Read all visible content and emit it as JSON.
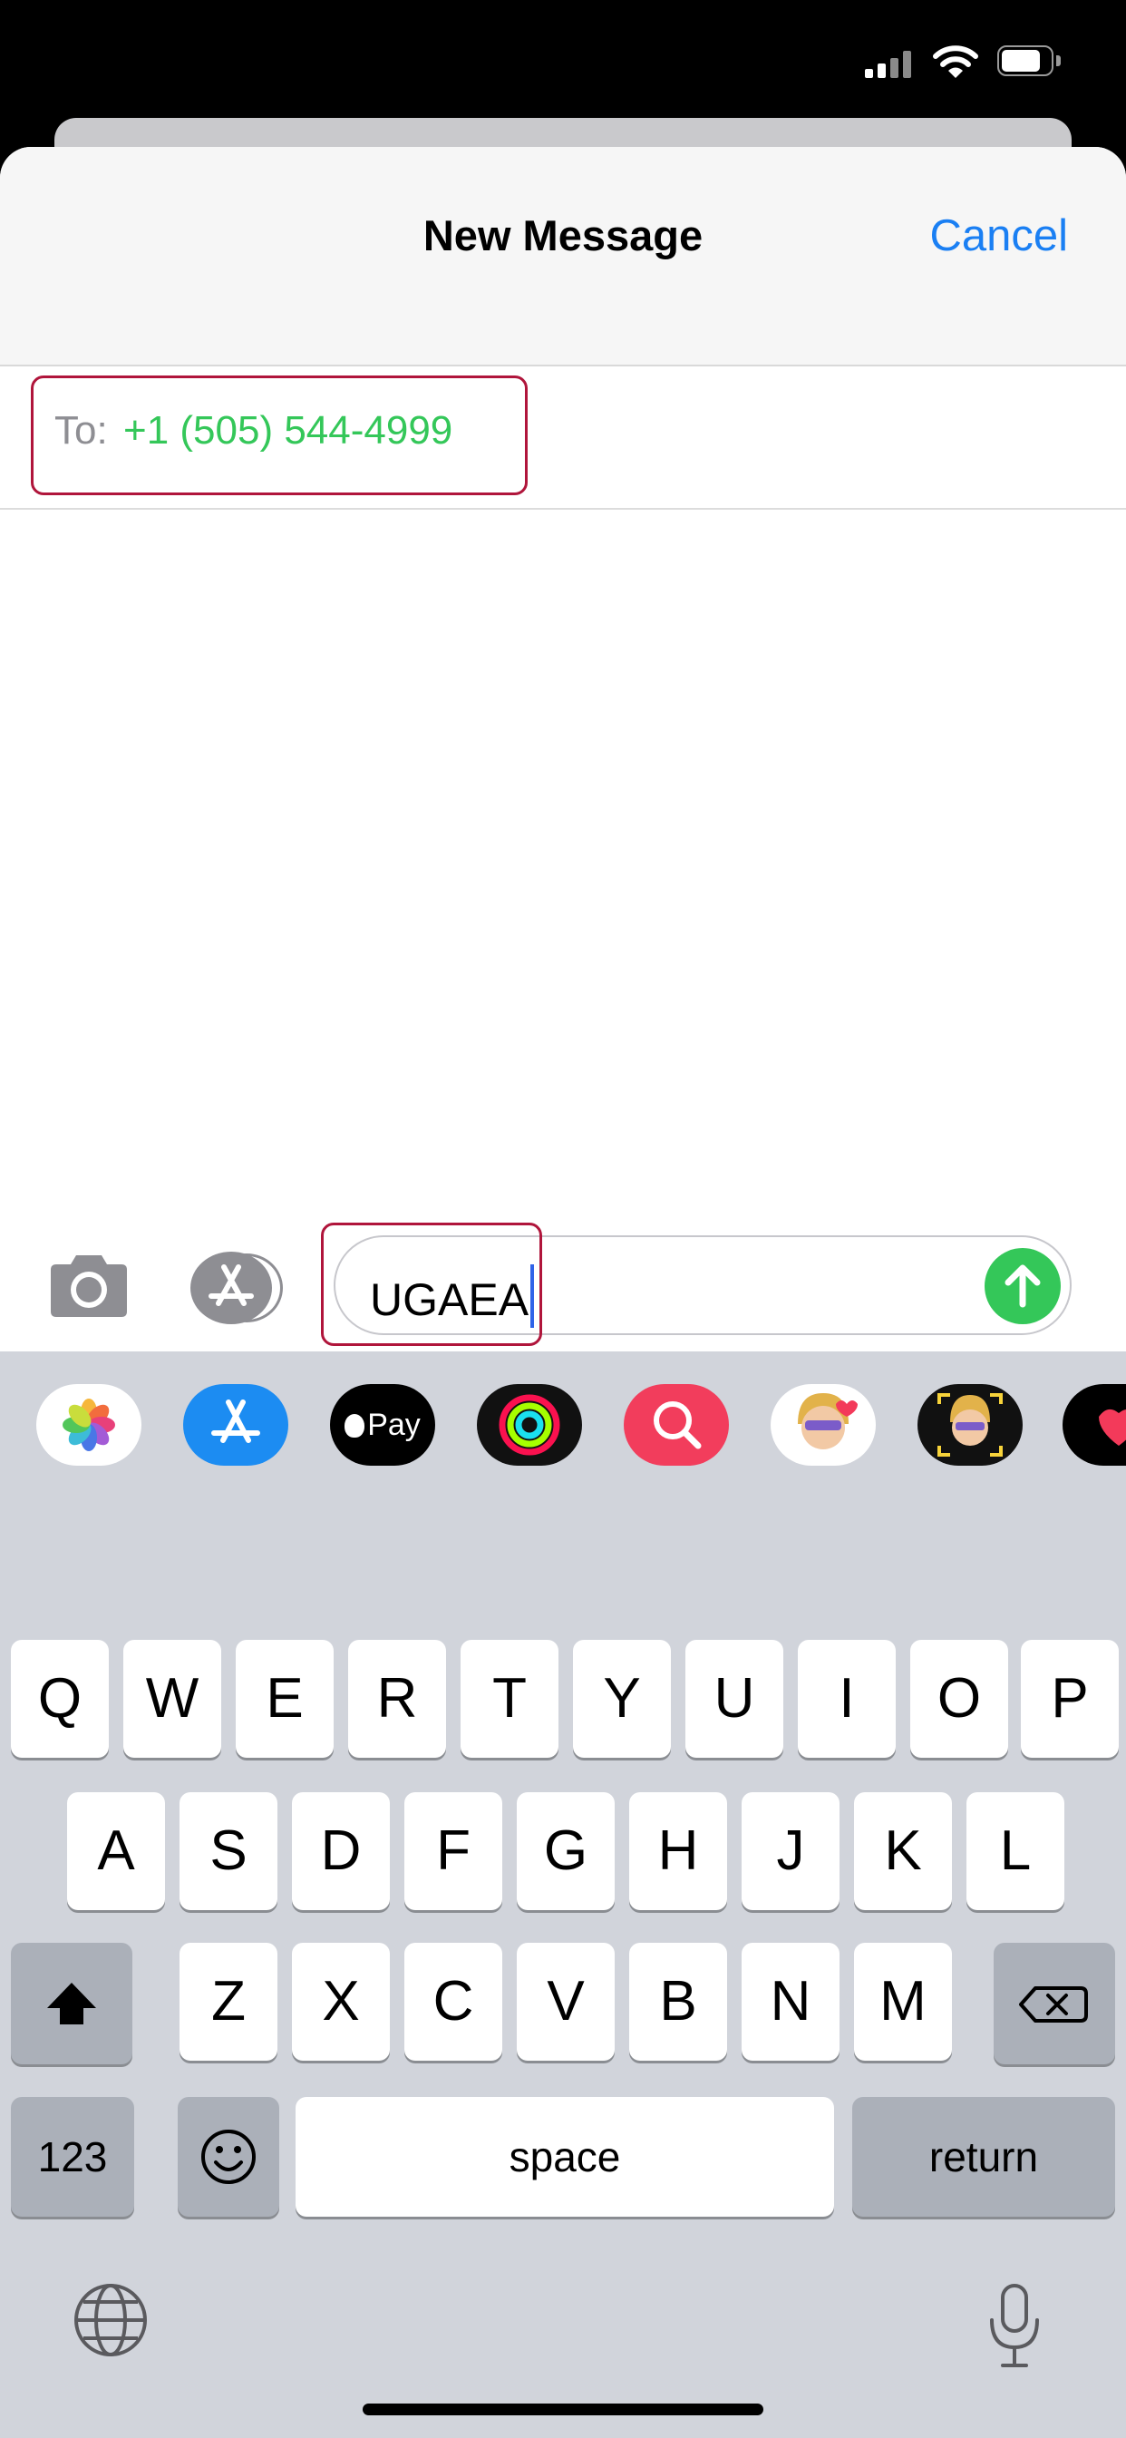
{
  "status_bar": {
    "icons": [
      "cellular-signal-icon",
      "wifi-icon",
      "battery-icon"
    ],
    "battery_level": 0.8
  },
  "sheet": {
    "title": "New Message",
    "cancel_label": "Cancel"
  },
  "recipient": {
    "label": "To:",
    "value": "+1 (505) 544-4999"
  },
  "compose": {
    "message_text": "UGAEA",
    "icons": [
      "camera-icon",
      "app-store-icon",
      "send-arrow-icon"
    ]
  },
  "app_strip": {
    "items": [
      "photos-app",
      "app-store-app",
      "apple-pay-app",
      "activity-app",
      "images-search-app",
      "memoji-stickers-app",
      "memoji-app",
      "digital-touch-app"
    ],
    "apple_pay_label": "Pay"
  },
  "keyboard": {
    "row1": [
      "Q",
      "W",
      "E",
      "R",
      "T",
      "Y",
      "U",
      "I",
      "O",
      "P"
    ],
    "row2": [
      "A",
      "S",
      "D",
      "F",
      "G",
      "H",
      "J",
      "K",
      "L"
    ],
    "row3": [
      "Z",
      "X",
      "C",
      "V",
      "B",
      "N",
      "M"
    ],
    "numbers_label": "123",
    "space_label": "space",
    "return_label": "return"
  },
  "colors": {
    "accent_blue": "#1a7ff3",
    "phone_green": "#34c759",
    "highlight_red": "#b0153b",
    "keyboard_bg": "#d1d4db"
  }
}
